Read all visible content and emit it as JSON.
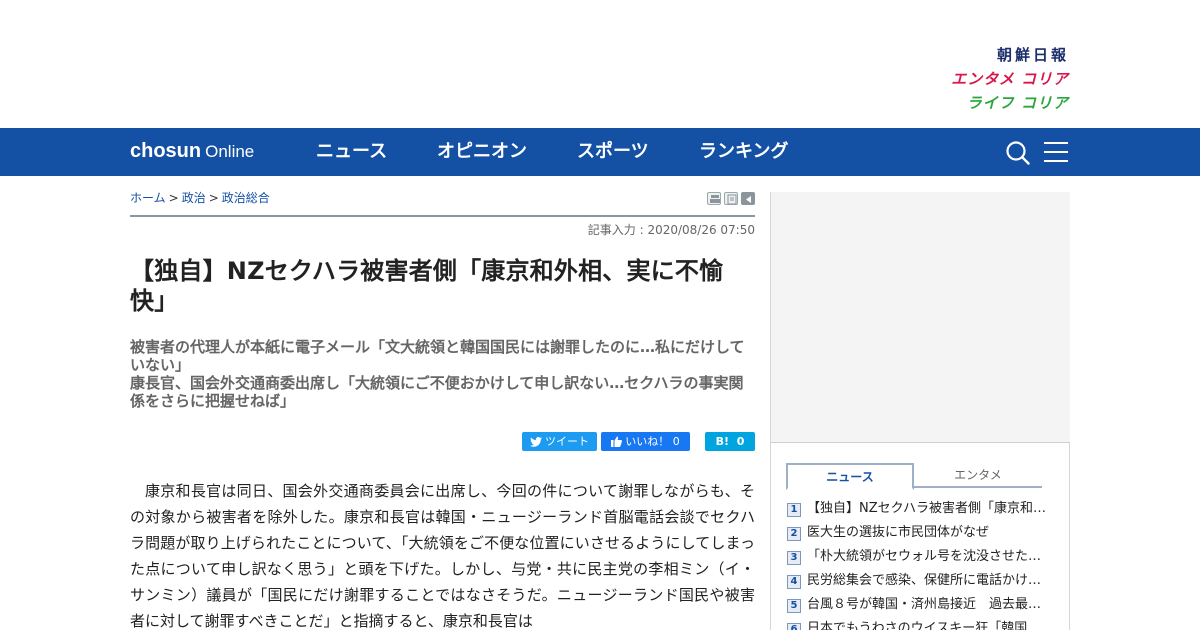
{
  "brand": {
    "chosun_label": "朝鮮日報",
    "entame_label": "エンタメ コリア",
    "life_label": "ライフ コリア"
  },
  "nav": {
    "logo_bold": "chosun",
    "logo_light": "Online",
    "items": [
      "ニュース",
      "オピニオン",
      "スポーツ",
      "ランキング"
    ],
    "icons": [
      "search-icon",
      "menu-icon"
    ]
  },
  "article": {
    "breadcrumb": [
      "ホーム",
      "政治",
      "政治総合"
    ],
    "timestamp": "記事入力 : 2020/08/26 07:50",
    "headline": "【独自】NZセクハラ被害者側「康京和外相、実に不愉快」",
    "subheads": [
      "被害者の代理人が本紙に電子メール「文大統領と韓国国民には謝罪したのに…私にだけしていない」",
      "康長官、国会外交通商委出席し「大統領にご不便おかけして申し訳ない…セクハラの事実関係をさらに把握せねば」"
    ],
    "share": {
      "tweet_label": "ツイート",
      "like_label": "いいね！",
      "like_count": "0",
      "hatena_label": "B!",
      "hatena_count": "0"
    },
    "body": "康京和長官は同日、国会外交通商委員会に出席し、今回の件について謝罪しながらも、その対象から被害者を除外した。康京和長官は韓国・ニュージーランド首脳電話会談でセクハラ問題が取り上げられたことについて、「大統領をご不便な位置にいさせるようにしてしまった点について申し訳なく思う」と頭を下げた。しかし、与党・共に民主党の李相ミン（イ・サンミン）議員が「国民にだけ謝罪することではなさそうだ。ニュージーランド国民や被害者に対して謝罪すべきことだ」と指摘すると、康京和長官は"
  },
  "sidebar": {
    "tabs": [
      "ニュース",
      "エンタメ"
    ],
    "ranking": [
      {
        "num": "1",
        "title": "【独自】NZセクハラ被害者側「康京和…"
      },
      {
        "num": "2",
        "title": "医大生の選抜に市民団体がなぜ"
      },
      {
        "num": "3",
        "title": "「朴大統領がセウォル号を沈没させた…"
      },
      {
        "num": "4",
        "title": "民労総集会で感染、保健所に電話かけ…"
      },
      {
        "num": "5",
        "title": "台風８号が韓国・済州島接近　過去最…"
      },
      {
        "num": "6",
        "title": "日本でもうわさのウイスキー狂「韓国…"
      }
    ]
  },
  "colors": {
    "nav_bg": "#1450a3",
    "tweet": "#1d9bf0",
    "facebook": "#1877f2",
    "hatena": "#00a4de"
  }
}
